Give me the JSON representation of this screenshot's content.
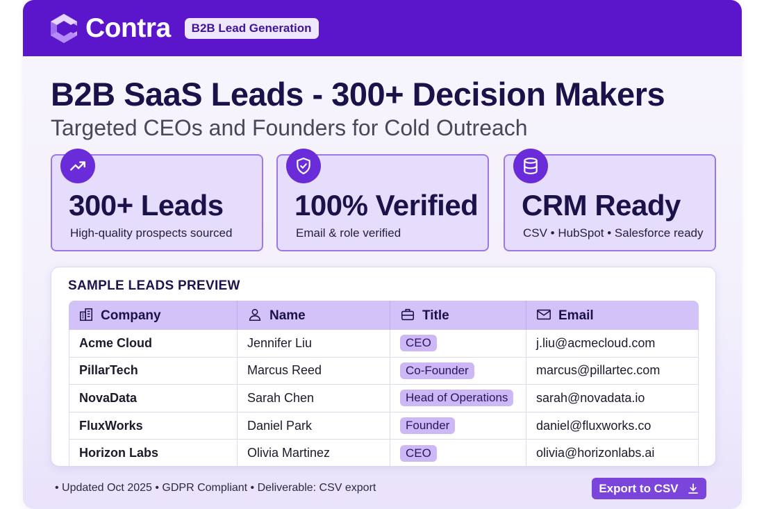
{
  "header": {
    "brand": "Contra",
    "badge": "B2B Lead Generation",
    "logo_icon": "contra-logo-icon",
    "color": "#5b16cc"
  },
  "title": "B2B SaaS Leads - 300+ Decision Makers",
  "subtitle": "Targeted CEOs and Founders for Cold Outreach",
  "stats": [
    {
      "icon": "trending-up-icon",
      "value": "300+ Leads",
      "caption": "High-quality prospects sourced"
    },
    {
      "icon": "shield-check-icon",
      "value": "100% Verified",
      "caption": "Email & role verified"
    },
    {
      "icon": "database-icon",
      "value": "CRM Ready",
      "caption": "CSV • HubSpot • Salesforce ready"
    }
  ],
  "preview": {
    "title": "SAMPLE LEADS PREVIEW",
    "columns": [
      {
        "icon": "building-icon",
        "label": "Company"
      },
      {
        "icon": "user-icon",
        "label": "Name"
      },
      {
        "icon": "briefcase-icon",
        "label": "Title"
      },
      {
        "icon": "mail-icon",
        "label": "Email"
      }
    ],
    "rows": [
      {
        "company": "Acme Cloud",
        "name": "Jennifer Liu",
        "title": "CEO",
        "email": "j.liu@acmecloud.com"
      },
      {
        "company": "PillarTech",
        "name": "Marcus Reed",
        "title": "Co-Founder",
        "email": "marcus@pillartec.com"
      },
      {
        "company": "NovaData",
        "name": "Sarah Chen",
        "title": "Head of Operations",
        "email": "sarah@novadata.io"
      },
      {
        "company": "FluxWorks",
        "name": "Daniel Park",
        "title": "Founder",
        "email": "daniel@fluxworks.co"
      },
      {
        "company": "Horizon Labs",
        "name": "Olivia Martinez",
        "title": "CEO",
        "email": "olivia@horizonlabs.ai"
      }
    ]
  },
  "footer": {
    "text": "• Updated Oct 2025 • GDPR Compliant • Deliverable: CSV export",
    "export_label": "Export to CSV",
    "export_icon": "download-icon",
    "accent": "#7b45dc"
  }
}
